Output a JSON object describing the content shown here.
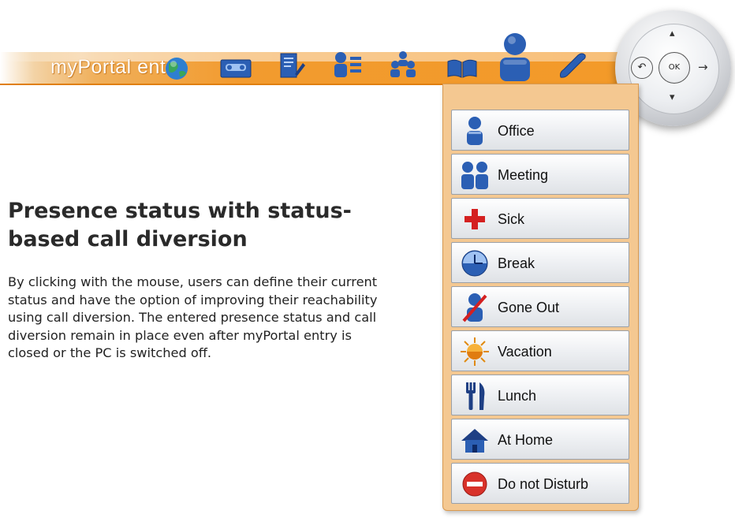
{
  "toolbar": {
    "brand": "myPortal entry",
    "icons": [
      "globe-icon",
      "voicemail-icon",
      "journal-icon",
      "directory-icon",
      "contacts-icon",
      "book-icon",
      "presence-icon",
      "phone-icon"
    ],
    "accent_color": "#f39a28"
  },
  "nav_wheel": {
    "ok_label": "OK",
    "back_glyph": "↶",
    "up_glyph": "▴",
    "down_glyph": "▾",
    "forward_glyph": "→"
  },
  "status_menu": {
    "items": [
      {
        "label": "Office",
        "icon": "office-person-icon"
      },
      {
        "label": "Meeting",
        "icon": "meeting-people-icon"
      },
      {
        "label": "Sick",
        "icon": "red-cross-icon"
      },
      {
        "label": "Break",
        "icon": "clock-icon"
      },
      {
        "label": "Gone Out",
        "icon": "gone-out-person-icon"
      },
      {
        "label": "Vacation",
        "icon": "sun-icon"
      },
      {
        "label": "Lunch",
        "icon": "fork-knife-icon"
      },
      {
        "label": "At Home",
        "icon": "house-icon"
      },
      {
        "label": "Do not Disturb",
        "icon": "no-entry-icon"
      }
    ]
  },
  "content": {
    "heading": "Presence status with status-based call diversion",
    "description": "By clicking with the mouse, users can define their current status and have the option of improving their reachability using call diversion. The entered presence status and call diversion remain in place even after myPortal entry is closed or the PC is switched off."
  }
}
